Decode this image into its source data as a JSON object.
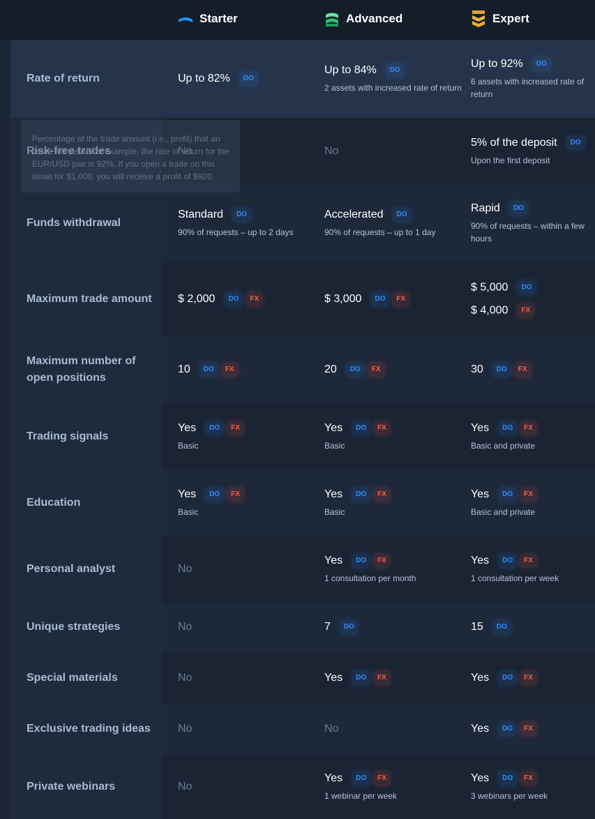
{
  "plans": [
    {
      "name": "Starter",
      "icon": "starter-rank-icon",
      "color": "#1e96ff"
    },
    {
      "name": "Advanced",
      "icon": "advanced-rank-icon",
      "color": "#2fbf71"
    },
    {
      "name": "Expert",
      "icon": "expert-rank-icon",
      "color": "#f0ad23"
    }
  ],
  "badges": {
    "do": "DO",
    "fx": "FX"
  },
  "tooltip": {
    "text": "Percentage of the trade amount (i.e., profit) that an asset will yield. For example, the rate of return for the EUR/USD pair is 92%. If you open a trade on this asset for $1,000, you will receive a profit of $920."
  },
  "rows": [
    {
      "label": "Rate of return",
      "cells": [
        {
          "value": "Up to 82%",
          "badges": [
            "do"
          ]
        },
        {
          "value": "Up to 84%",
          "badges": [
            "do"
          ],
          "sub": "2 assets with increased rate of return"
        },
        {
          "value": "Up to 92%",
          "badges": [
            "do"
          ],
          "sub": "6 assets with increased rate of return"
        }
      ]
    },
    {
      "label": "Risk-free trades",
      "cells": [
        {
          "value": "No",
          "no": true
        },
        {
          "value": "No",
          "no": true
        },
        {
          "value": "5% of the deposit",
          "badges": [
            "do"
          ],
          "sub": "Upon the first deposit"
        }
      ]
    },
    {
      "label": "Funds withdrawal",
      "cells": [
        {
          "value": "Standard",
          "badges": [
            "do"
          ],
          "sub": "90% of requests – up to 2 days"
        },
        {
          "value": "Accelerated",
          "badges": [
            "do"
          ],
          "sub": "90% of requests – up to 1 day"
        },
        {
          "value": "Rapid",
          "badges": [
            "do"
          ],
          "sub": "90% of requests – within a few hours"
        }
      ]
    },
    {
      "label": "Maximum trade amount",
      "cells": [
        {
          "value": "$ 2,000",
          "badges": [
            "do",
            "fx"
          ]
        },
        {
          "value": "$ 3,000",
          "badges": [
            "do",
            "fx"
          ]
        },
        {
          "lines": [
            {
              "value": "$ 5,000",
              "badges": [
                "do"
              ]
            },
            {
              "value": "$ 4,000",
              "badges": [
                "fx"
              ]
            }
          ]
        }
      ]
    },
    {
      "label": "Maximum number of open positions",
      "cells": [
        {
          "value": "10",
          "badges": [
            "do",
            "fx"
          ]
        },
        {
          "value": "20",
          "badges": [
            "do",
            "fx"
          ]
        },
        {
          "value": "30",
          "badges": [
            "do",
            "fx"
          ]
        }
      ]
    },
    {
      "label": "Trading signals",
      "cells": [
        {
          "value": "Yes",
          "badges": [
            "do",
            "fx"
          ],
          "sub": "Basic"
        },
        {
          "value": "Yes",
          "badges": [
            "do",
            "fx"
          ],
          "sub": "Basic"
        },
        {
          "value": "Yes",
          "badges": [
            "do",
            "fx"
          ],
          "sub": "Basic and private"
        }
      ]
    },
    {
      "label": "Education",
      "cells": [
        {
          "value": "Yes",
          "badges": [
            "do",
            "fx"
          ],
          "sub": "Basic"
        },
        {
          "value": "Yes",
          "badges": [
            "do",
            "fx"
          ],
          "sub": "Basic"
        },
        {
          "value": "Yes",
          "badges": [
            "do",
            "fx"
          ],
          "sub": "Basic and private"
        }
      ]
    },
    {
      "label": "Personal analyst",
      "cells": [
        {
          "value": "No",
          "no": true
        },
        {
          "value": "Yes",
          "badges": [
            "do",
            "fx"
          ],
          "sub": "1 consultation per month"
        },
        {
          "value": "Yes",
          "badges": [
            "do",
            "fx"
          ],
          "sub": "1 consultation per week"
        }
      ]
    },
    {
      "label": "Unique strategies",
      "cells": [
        {
          "value": "No",
          "no": true
        },
        {
          "value": "7",
          "badges": [
            "do"
          ]
        },
        {
          "value": "15",
          "badges": [
            "do"
          ]
        }
      ]
    },
    {
      "label": "Special materials",
      "cells": [
        {
          "value": "No",
          "no": true
        },
        {
          "value": "Yes",
          "badges": [
            "do",
            "fx"
          ]
        },
        {
          "value": "Yes",
          "badges": [
            "do",
            "fx"
          ]
        }
      ]
    },
    {
      "label": "Exclusive trading ideas",
      "cells": [
        {
          "value": "No",
          "no": true
        },
        {
          "value": "No",
          "no": true
        },
        {
          "value": "Yes",
          "badges": [
            "do",
            "fx"
          ]
        }
      ]
    },
    {
      "label": "Private webinars",
      "cells": [
        {
          "value": "No",
          "no": true
        },
        {
          "value": "Yes",
          "badges": [
            "do",
            "fx"
          ],
          "sub": "1 webinar per week"
        },
        {
          "value": "Yes",
          "badges": [
            "do",
            "fx"
          ],
          "sub": "3 webinars per week"
        }
      ]
    }
  ]
}
